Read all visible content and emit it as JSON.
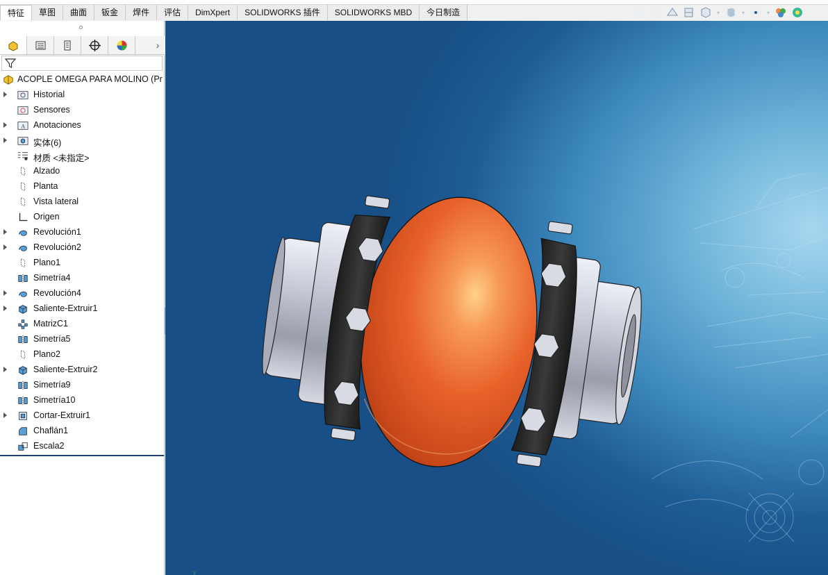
{
  "ribbon": {
    "tabs": [
      {
        "label": "特征",
        "active": true
      },
      {
        "label": "草图"
      },
      {
        "label": "曲面"
      },
      {
        "label": "钣金"
      },
      {
        "label": "焊件"
      },
      {
        "label": "评估"
      },
      {
        "label": "DimXpert"
      },
      {
        "label": "SOLIDWORKS 插件"
      },
      {
        "label": "SOLIDWORKS MBD"
      },
      {
        "label": "今日制造"
      }
    ]
  },
  "heads_up_toolbar": {
    "icons": [
      "zoom-to-fit-icon",
      "zoom-area-icon",
      "previous-view-icon",
      "section-view-icon",
      "view-orientation-icon",
      "display-style-icon",
      "hide-show-icon",
      "edit-appearance-icon",
      "apply-scene-icon"
    ]
  },
  "manager_tabs": [
    {
      "icon": "feature-manager-icon",
      "active": true
    },
    {
      "icon": "property-manager-icon"
    },
    {
      "icon": "configuration-manager-icon"
    },
    {
      "icon": "dimxpert-manager-icon"
    },
    {
      "icon": "display-manager-icon"
    }
  ],
  "tree": {
    "root": {
      "label": "ACOPLE OMEGA PARA MOLINO  (Pr",
      "icon": "part-icon"
    },
    "items": [
      {
        "label": "Historial",
        "icon": "history-folder-icon",
        "expandable": true
      },
      {
        "label": "Sensores",
        "icon": "sensors-folder-icon",
        "expandable": false
      },
      {
        "label": "Anotaciones",
        "icon": "annotations-folder-icon",
        "expandable": true
      },
      {
        "label": "实体(6)",
        "icon": "solid-bodies-folder-icon",
        "expandable": true
      },
      {
        "label": "材质 <未指定>",
        "icon": "material-icon",
        "expandable": false
      },
      {
        "label": "Alzado",
        "icon": "plane-icon",
        "expandable": false
      },
      {
        "label": "Planta",
        "icon": "plane-icon",
        "expandable": false
      },
      {
        "label": "Vista lateral",
        "icon": "plane-icon",
        "expandable": false
      },
      {
        "label": "Origen",
        "icon": "origin-icon",
        "expandable": false
      },
      {
        "label": "Revolución1",
        "icon": "revolve-icon",
        "expandable": true
      },
      {
        "label": "Revolución2",
        "icon": "revolve-icon",
        "expandable": true
      },
      {
        "label": "Plano1",
        "icon": "plane-icon",
        "expandable": false
      },
      {
        "label": "Simetría4",
        "icon": "mirror-icon",
        "expandable": false
      },
      {
        "label": "Revolución4",
        "icon": "revolve-icon",
        "expandable": true
      },
      {
        "label": "Saliente-Extruir1",
        "icon": "extrude-boss-icon",
        "expandable": true
      },
      {
        "label": "MatrizC1",
        "icon": "circular-pattern-icon",
        "expandable": false
      },
      {
        "label": "Simetría5",
        "icon": "mirror-icon",
        "expandable": false
      },
      {
        "label": "Plano2",
        "icon": "plane-icon",
        "expandable": false
      },
      {
        "label": "Saliente-Extruir2",
        "icon": "extrude-boss-icon",
        "expandable": true
      },
      {
        "label": "Simetría9",
        "icon": "mirror-icon",
        "expandable": false
      },
      {
        "label": "Simetría10",
        "icon": "mirror-icon",
        "expandable": false
      },
      {
        "label": "Cortar-Extruir1",
        "icon": "extrude-cut-icon",
        "expandable": true
      },
      {
        "label": "Chaflán1",
        "icon": "chamfer-icon",
        "expandable": false
      },
      {
        "label": "Escala2",
        "icon": "scale-icon",
        "expandable": false
      }
    ]
  },
  "colors": {
    "body_orange": "#e8622a",
    "clamp_black": "#222222",
    "hub_steel": "#b9bcc9",
    "viewport_dark": "#174f86",
    "viewport_light": "#a7d7ef"
  }
}
